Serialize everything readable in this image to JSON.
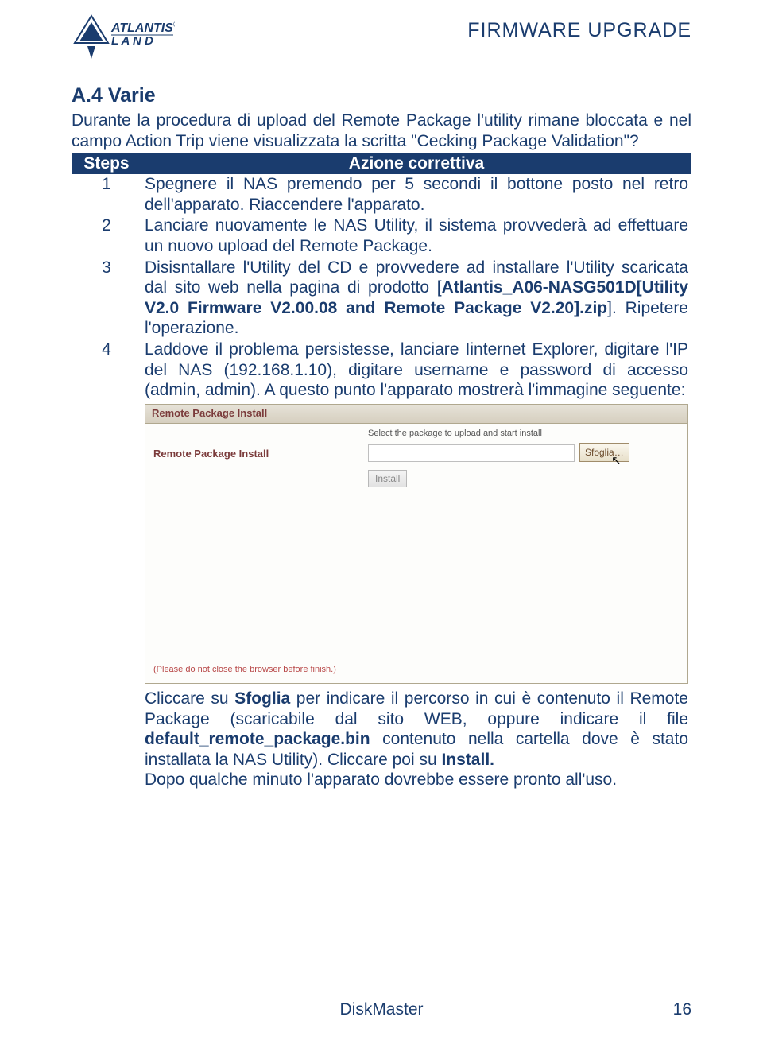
{
  "header": {
    "logo_name": "ATLANTIS",
    "title": "FIRMWARE UPGRADE"
  },
  "section": {
    "heading": "A.4 Varie",
    "intro": "Durante la procedura di upload del Remote Package l'utility rimane bloccata e nel campo Action Trip viene visualizzata la scritta \"Cecking Package Validation\"?"
  },
  "table": {
    "col1": "Steps",
    "col2": "Azione correttiva",
    "rows": [
      {
        "n": "1",
        "text": "Spegnere il NAS premendo per 5 secondi il bottone posto nel retro dell'apparato. Riaccendere l'apparato."
      },
      {
        "n": "2",
        "text": "Lanciare nuovamente le NAS Utility, il sistema provvederà ad effettuare un nuovo upload del Remote Package."
      },
      {
        "n": "3",
        "t1": "Disisntallare l'Utility del CD e provvedere ad installare l'Utility scaricata dal sito web nella pagina di prodotto [",
        "b1": "Atlantis_A06-NASG501D[Utility V2.0 Firmware V2.00.08 and Remote Package V2.20].zip",
        "t2": "]. Ripetere l'operazione."
      },
      {
        "n": "4",
        "t1": "Laddove il problema persistesse, lanciare Iinternet Explorer, digitare l'IP del NAS (192.168.1.10), digitare username e password di accesso (admin, admin). A questo punto l'apparato mostrerà l'immagine seguente:",
        "post_p1a": "Cliccare su ",
        "post_b1": "Sfoglia",
        "post_p1b": " per indicare il percorso in cui è contenuto il Remote Package (scaricabile dal sito WEB, oppure indicare il file ",
        "post_b2": "default_remote_package.bin",
        "post_p1c": " contenuto nella cartella dove è stato installata la NAS Utility). Cliccare poi su ",
        "post_b3": "Install.",
        "post_p2": "Dopo qualche minuto l'apparato dovrebbe essere pronto all'uso."
      }
    ]
  },
  "screenshot": {
    "title": "Remote Package Install",
    "side_label": "Remote Package Install",
    "select_label": "Select the package to upload and start install",
    "browse": "Sfoglia…",
    "install": "Install",
    "note": "(Please do not close the browser before finish.)"
  },
  "footer": {
    "product": "DiskMaster",
    "page": "16"
  }
}
